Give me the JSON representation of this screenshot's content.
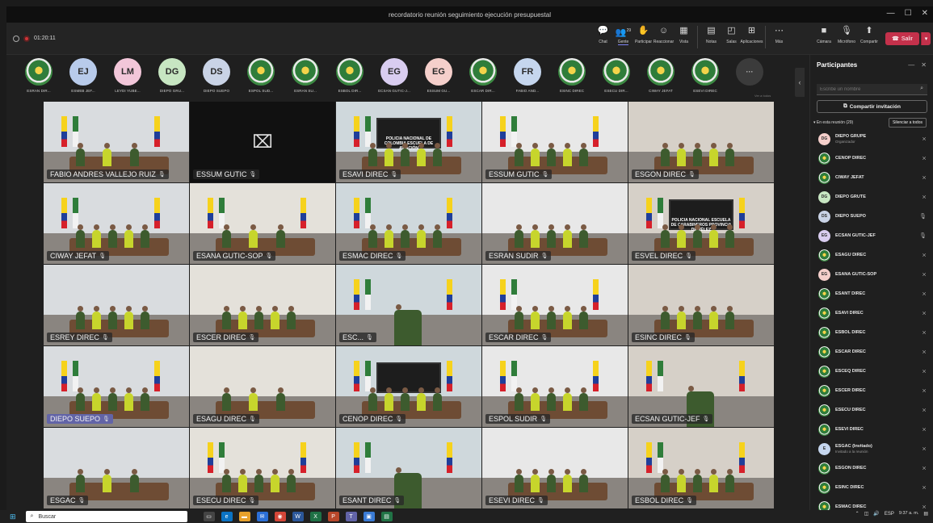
{
  "window": {
    "title": "recordatorio reunión seguimiento ejecución presupuestal",
    "controls": [
      "—",
      "☐",
      "✕"
    ]
  },
  "recording": {
    "time": "01:20:11"
  },
  "toolbar": {
    "items": [
      {
        "id": "chat",
        "label": "Chat",
        "icon": "chat-icon",
        "glyph": "💬"
      },
      {
        "id": "gente",
        "label": "Gente",
        "icon": "people-icon",
        "glyph": "👥",
        "badge": "29",
        "active": true
      },
      {
        "id": "participar",
        "label": "Participar",
        "icon": "hand-icon",
        "glyph": "✋"
      },
      {
        "id": "reaccionar",
        "label": "Reaccionar",
        "icon": "smile-icon",
        "glyph": "☺"
      },
      {
        "id": "vista",
        "label": "Vista",
        "icon": "grid-icon",
        "glyph": "▦"
      },
      {
        "id": "notas",
        "label": "Notas",
        "icon": "notes-icon",
        "glyph": "▤"
      },
      {
        "id": "salas",
        "label": "Salas",
        "icon": "rooms-icon",
        "glyph": "◰"
      },
      {
        "id": "aplicaciones",
        "label": "Aplicaciones",
        "icon": "apps-icon",
        "glyph": "⊞"
      },
      {
        "id": "mas",
        "label": "Más",
        "icon": "more-icon",
        "glyph": "⋯"
      }
    ],
    "devices": [
      {
        "id": "camara",
        "label": "Cámara",
        "icon": "camera-icon",
        "glyph": "■"
      },
      {
        "id": "microfono",
        "label": "Micrófono",
        "icon": "mic-icon",
        "glyph": "🎙"
      },
      {
        "id": "compartir",
        "label": "Compartir",
        "icon": "share-screen-icon",
        "glyph": "⬆"
      }
    ],
    "leave_label": "Salir"
  },
  "strip": {
    "participants": [
      {
        "name": "ESRAN DIR...",
        "avatar": "emblem"
      },
      {
        "name": "ESMEB JEF...",
        "initials": "EJ",
        "color": "#b8cbeb"
      },
      {
        "name": "LEYDI YUBE...",
        "initials": "LM",
        "color": "#f2c6d9"
      },
      {
        "name": "DIEPO GRU...",
        "initials": "DG",
        "color": "#c7e6c2"
      },
      {
        "name": "DIEPO SUEPO",
        "initials": "DS",
        "color": "#c9d3e6"
      },
      {
        "name": "ESPOL SUD...",
        "avatar": "emblem"
      },
      {
        "name": "ESRAN SU...",
        "avatar": "emblem"
      },
      {
        "name": "ESBOL DIR...",
        "avatar": "emblem"
      },
      {
        "name": "ECSAN GUTIC-J...",
        "initials": "EG",
        "color": "#d9cdf0"
      },
      {
        "name": "ESSUM GU...",
        "initials": "EG",
        "color": "#f5cfcb"
      },
      {
        "name": "ESCAR DIR...",
        "avatar": "emblem"
      },
      {
        "name": "FABIO AND...",
        "initials": "FR",
        "color": "#c5d6ee"
      },
      {
        "name": "ESINC DIREC",
        "avatar": "emblem"
      },
      {
        "name": "ESECU DIR...",
        "avatar": "emblem"
      },
      {
        "name": "CIWAY JEFAT",
        "avatar": "emblem"
      },
      {
        "name": "ESEVI DIREC",
        "avatar": "emblem"
      }
    ],
    "more_label": "···",
    "see_all": "Ver a todos"
  },
  "tiles": [
    {
      "label": "FABIO ANDRES VALLEJO RUIZ",
      "scene": "office"
    },
    {
      "label": "ESSUM GUTIC",
      "scene": "camoff"
    },
    {
      "label": "ESAVI DIREC",
      "scene": "screen",
      "screen_text": "POLICIA NACIONAL DE COLOMBIA ESCUELA DE AVIACIÓN"
    },
    {
      "label": "ESSUM GUTIC",
      "scene": "meeting"
    },
    {
      "label": "ESGON DIREC",
      "scene": "meeting"
    },
    {
      "label": "CIWAY JEFAT",
      "scene": "flags"
    },
    {
      "label": "ESANA GUTIC-SOP",
      "scene": "office"
    },
    {
      "label": "ESMAC DIREC",
      "scene": "flags"
    },
    {
      "label": "ESRAN SUDIR",
      "scene": "meeting"
    },
    {
      "label": "ESVEL DIREC",
      "scene": "screen",
      "screen_text": "POLICIA NACIONAL ESCUELA DE CARABINEROS PROVINCIA DE VÉLEZ"
    },
    {
      "label": "ESREY DIREC",
      "scene": "meeting"
    },
    {
      "label": "ESCER DIREC",
      "scene": "meeting"
    },
    {
      "label": "ESC...",
      "scene": "closeup"
    },
    {
      "label": "ESCAR DIREC",
      "scene": "flags"
    },
    {
      "label": "ESINC DIREC",
      "scene": "meeting"
    },
    {
      "label": "DIEPO SUEPO",
      "scene": "meeting",
      "highlight": true
    },
    {
      "label": "ESAGU DIREC",
      "scene": "office"
    },
    {
      "label": "CENOP DIREC",
      "scene": "screen",
      "screen_text": ""
    },
    {
      "label": "ESPOL SUDIR",
      "scene": "meeting"
    },
    {
      "label": "ECSAN GUTIC-JEF",
      "scene": "closeup"
    },
    {
      "label": "ESGAC",
      "scene": "office"
    },
    {
      "label": "ESECU DIREC",
      "scene": "meeting"
    },
    {
      "label": "ESANT DIREC",
      "scene": "closeup"
    },
    {
      "label": "ESEVI DIREC",
      "scene": "meeting"
    },
    {
      "label": "ESBOL DIREC",
      "scene": "meeting"
    }
  ],
  "panel": {
    "title": "Participantes",
    "search_placeholder": "Escribe un nombre",
    "share_label": "Compartir invitación",
    "in_meeting_label": "En esta reunión (29)",
    "mute_all_label": "Silenciar a todos",
    "participants": [
      {
        "name": "DIEPO GRUPE",
        "sub": "Organizador",
        "initials": "DG",
        "color": "#f5cfcb"
      },
      {
        "name": "CENOP DIREC",
        "avatar": "emblem"
      },
      {
        "name": "CIWAY JEFAT",
        "avatar": "emblem"
      },
      {
        "name": "DIEPO GRUTE",
        "initials": "DG",
        "color": "#c7e6c2"
      },
      {
        "name": "DIEPO SUEPO",
        "initials": "DS",
        "color": "#c9d3e6"
      },
      {
        "name": "ECSAN GUTIC-JEF",
        "initials": "EG",
        "color": "#d9cdf0"
      },
      {
        "name": "ESAGU DIREC",
        "avatar": "emblem"
      },
      {
        "name": "ESANA GUTIC-SOP",
        "initials": "EG",
        "color": "#f5cfcb"
      },
      {
        "name": "ESANT DIREC",
        "avatar": "emblem"
      },
      {
        "name": "ESAVI DIREC",
        "avatar": "emblem"
      },
      {
        "name": "ESBOL DIREC",
        "avatar": "emblem"
      },
      {
        "name": "ESCAR DIREC",
        "avatar": "emblem"
      },
      {
        "name": "ESCEQ DIREC",
        "avatar": "emblem"
      },
      {
        "name": "ESCER DIREC",
        "avatar": "emblem"
      },
      {
        "name": "ESECU DIREC",
        "avatar": "emblem"
      },
      {
        "name": "ESEVI DIREC",
        "avatar": "emblem"
      },
      {
        "name": "ESGAC (Invitado)",
        "sub": "Invitado a la reunión",
        "initials": "E",
        "color": "#c5d6ee"
      },
      {
        "name": "ESGON DIREC",
        "avatar": "emblem"
      },
      {
        "name": "ESINC DIREC",
        "avatar": "emblem"
      },
      {
        "name": "ESMAC DIREC",
        "avatar": "emblem"
      }
    ]
  },
  "taskbar": {
    "search_placeholder": "Buscar",
    "lang": "ESP",
    "time": "9:37 a. m."
  }
}
